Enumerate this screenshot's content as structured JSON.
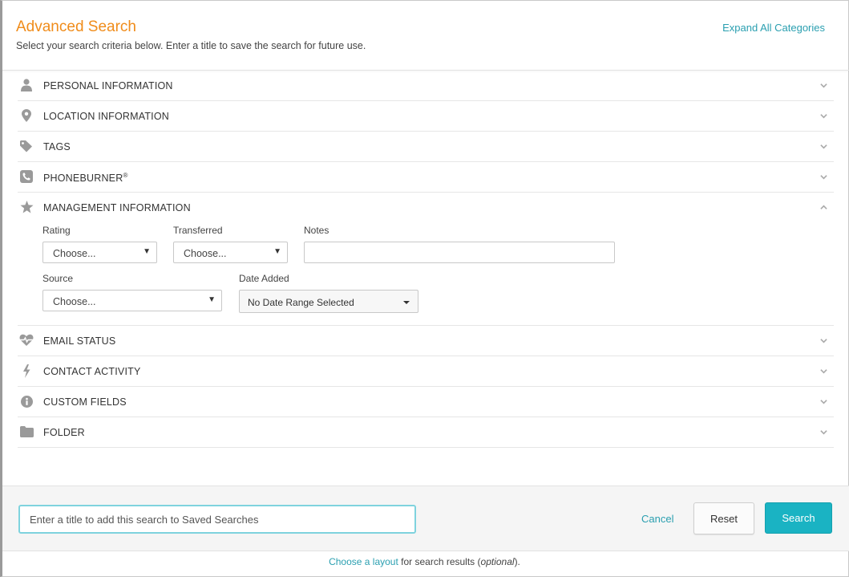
{
  "header": {
    "title": "Advanced Search",
    "subtitle": "Select your search criteria below. Enter a title to save the search for future use.",
    "expand_all": "Expand All Categories"
  },
  "sections": [
    {
      "label": "PERSONAL INFORMATION",
      "icon": "person-icon",
      "expanded": false
    },
    {
      "label": "LOCATION INFORMATION",
      "icon": "map-pin-icon",
      "expanded": false
    },
    {
      "label": "TAGS",
      "icon": "tag-icon",
      "expanded": false
    },
    {
      "label": "PHONEBURNER",
      "sup": "®",
      "icon": "phone-icon",
      "expanded": false
    },
    {
      "label": "MANAGEMENT INFORMATION",
      "icon": "star-icon",
      "expanded": true
    },
    {
      "label": "EMAIL STATUS",
      "icon": "heart-pulse-icon",
      "expanded": false
    },
    {
      "label": "CONTACT ACTIVITY",
      "icon": "lightning-icon",
      "expanded": false
    },
    {
      "label": "CUSTOM FIELDS",
      "icon": "info-icon",
      "expanded": false
    },
    {
      "label": "FOLDER",
      "icon": "folder-icon",
      "expanded": false
    }
  ],
  "management": {
    "rating_label": "Rating",
    "rating_value": "Choose...",
    "transferred_label": "Transferred",
    "transferred_value": "Choose...",
    "notes_label": "Notes",
    "notes_value": "",
    "source_label": "Source",
    "source_value": "Choose...",
    "date_added_label": "Date Added",
    "date_added_value": "No Date Range Selected"
  },
  "footer": {
    "save_placeholder": "Enter a title to add this search to Saved Searches",
    "cancel_label": "Cancel",
    "reset_label": "Reset",
    "search_label": "Search",
    "note_link": "Choose a layout",
    "note_text": " for search results (",
    "note_em": "optional",
    "note_end": ")."
  },
  "colors": {
    "title": "#f08c1a",
    "link": "#2a9fb0",
    "primary_button": "#1ab3c3",
    "icon": "#9a9a9a"
  }
}
